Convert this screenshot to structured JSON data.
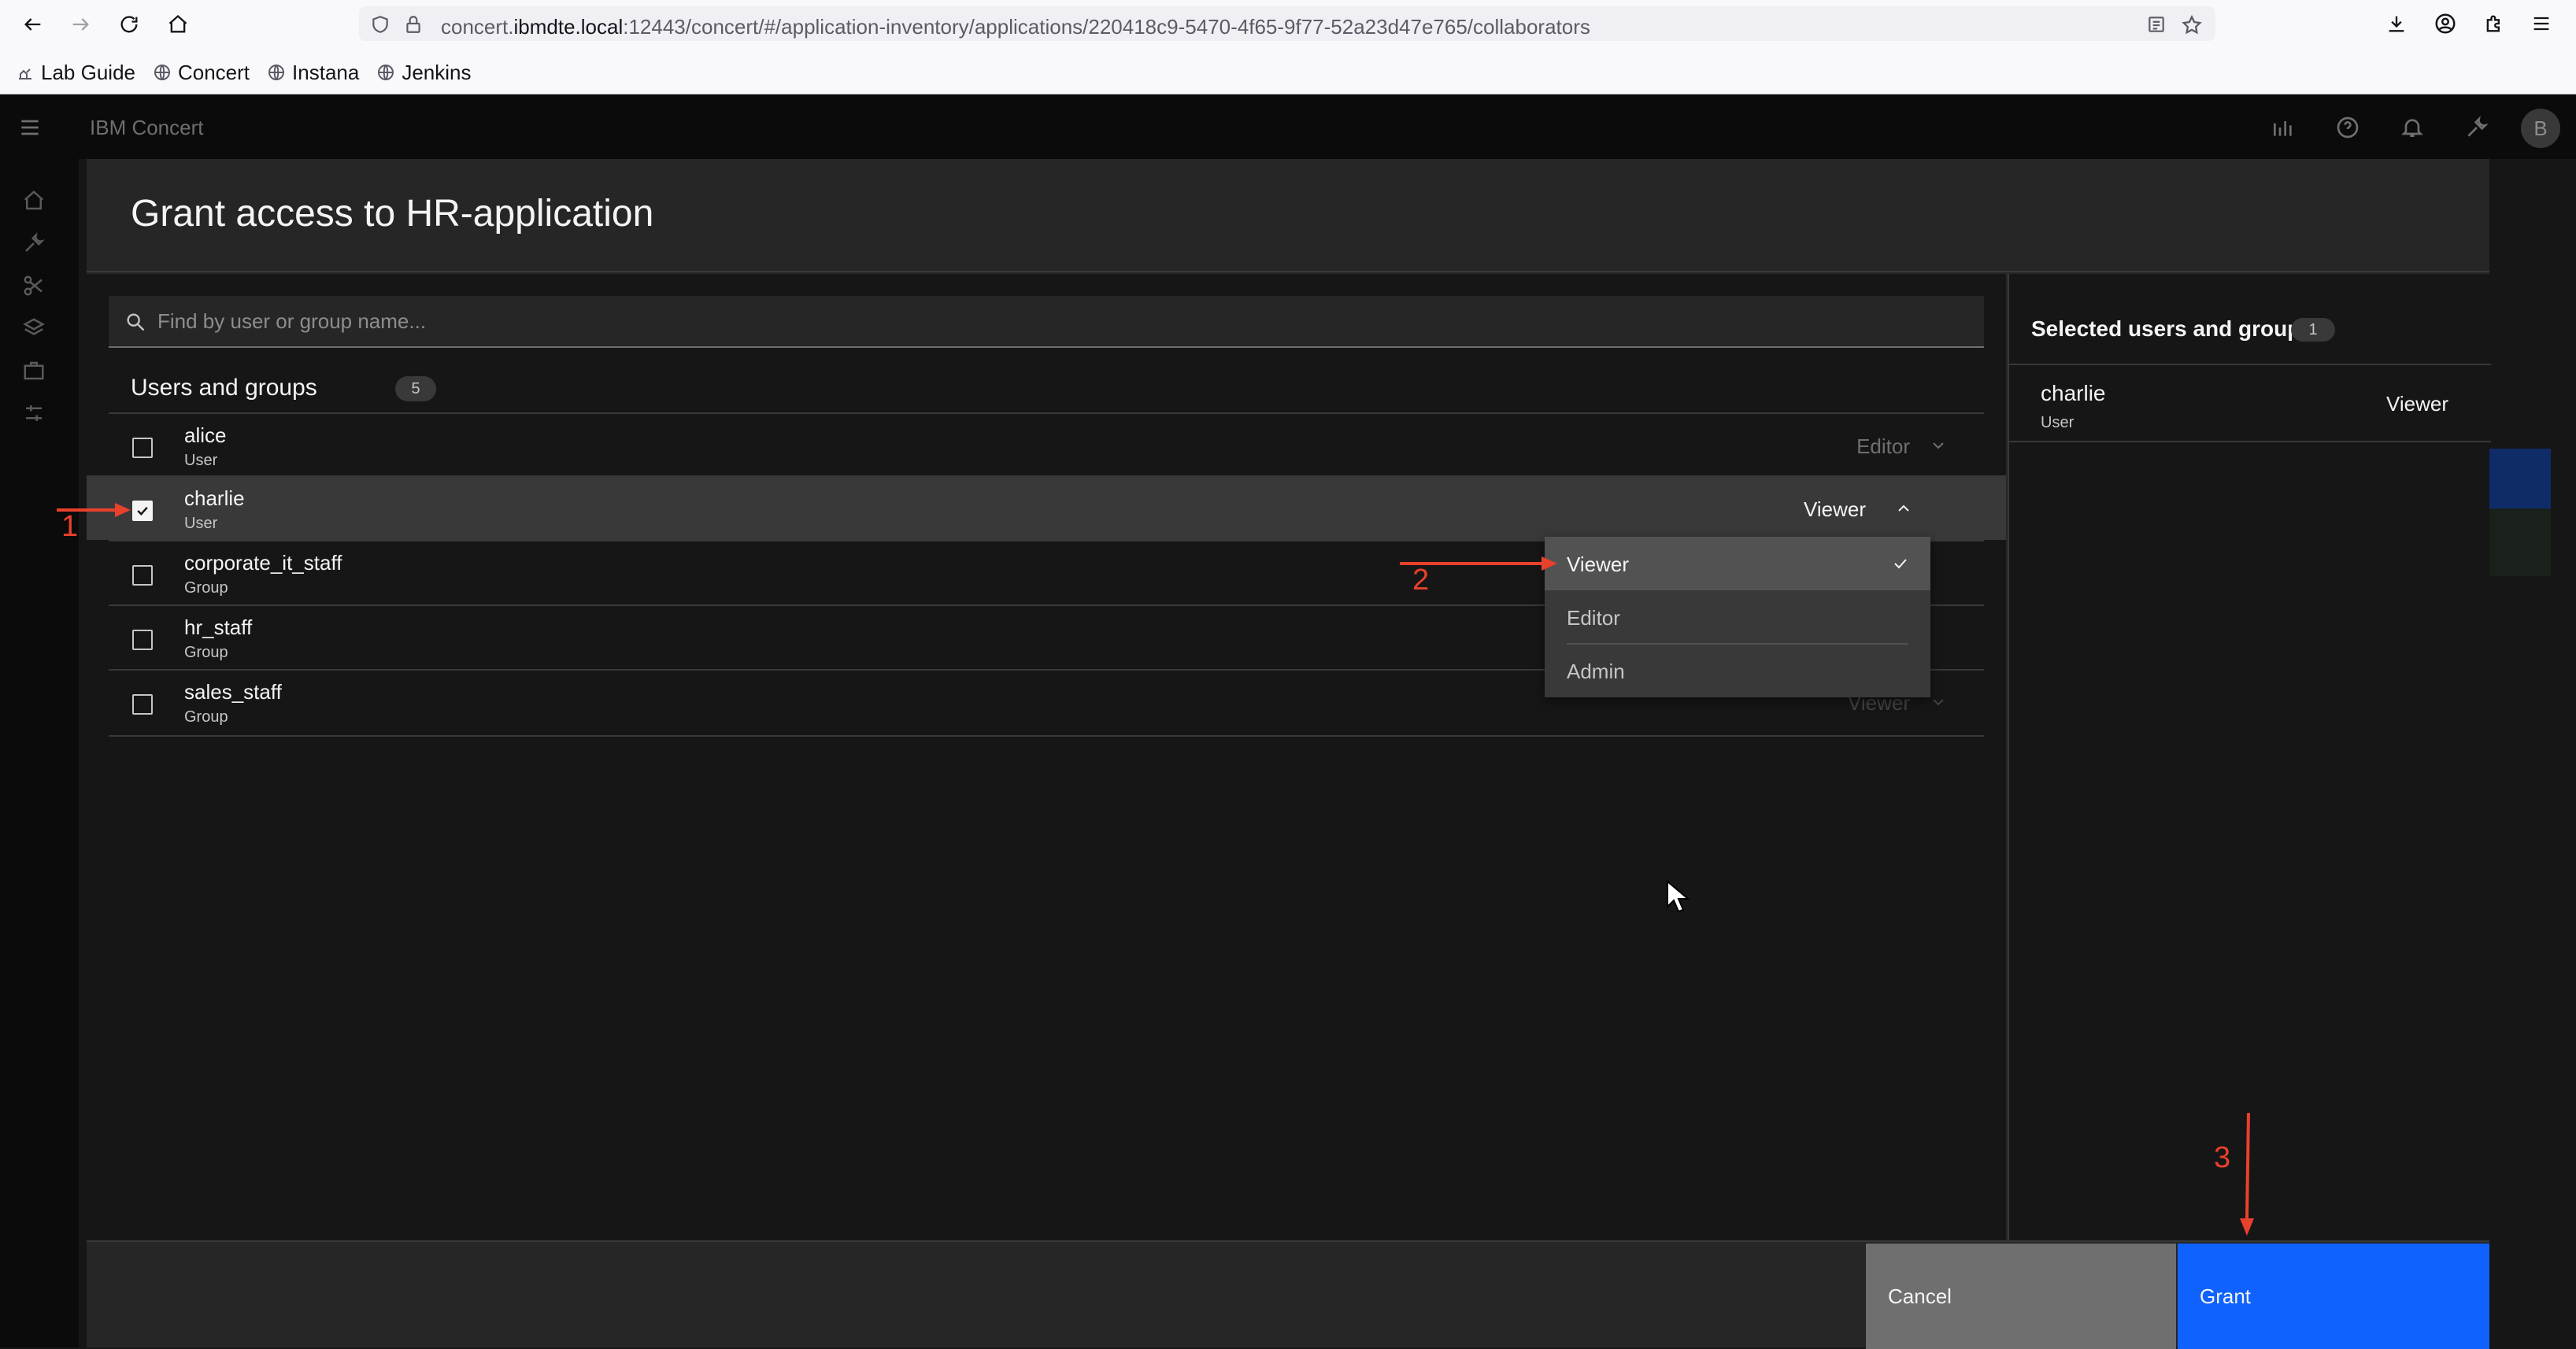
{
  "browser": {
    "url_prefix": "concert.",
    "url_domain": "ibmdte.local",
    "url_rest": ":12443/concert/#/application-inventory/applications/220418c9-5470-4f65-9f77-52a23d47e765/collaborators",
    "bookmarks": [
      {
        "label": "Lab Guide",
        "icon": "lab-icon"
      },
      {
        "label": "Concert",
        "icon": "globe-icon"
      },
      {
        "label": "Instana",
        "icon": "globe-icon"
      },
      {
        "label": "Jenkins",
        "icon": "globe-icon"
      }
    ]
  },
  "app": {
    "brand": "IBM Concert",
    "avatar_initial": "B"
  },
  "modal": {
    "title": "Grant access to HR-application",
    "search_placeholder": "Find by user or group name...",
    "list_title": "Users and groups",
    "list_count": "5",
    "rows": [
      {
        "name": "alice",
        "type": "User",
        "role": "Editor",
        "checked": false
      },
      {
        "name": "charlie",
        "type": "User",
        "role": "Viewer",
        "checked": true
      },
      {
        "name": "corporate_it_staff",
        "type": "Group",
        "role": "",
        "checked": false
      },
      {
        "name": "hr_staff",
        "type": "Group",
        "role": "",
        "checked": false
      },
      {
        "name": "sales_staff",
        "type": "Group",
        "role": "Viewer",
        "checked": false
      }
    ],
    "role_menu": {
      "options": [
        "Viewer",
        "Editor",
        "Admin"
      ],
      "selected": "Viewer"
    },
    "selected_title": "Selected users and groups",
    "selected_count": "1",
    "selected_items": [
      {
        "name": "charlie",
        "type": "User",
        "role": "Viewer"
      }
    ],
    "cancel_label": "Cancel",
    "grant_label": "Grant"
  },
  "annotations": {
    "step1": "1",
    "step2": "2",
    "step3": "3",
    "color": "#e8412c"
  },
  "colors": {
    "primary_button": "#0f62fe",
    "secondary_button": "#6f6f6f",
    "background": "#161616"
  }
}
